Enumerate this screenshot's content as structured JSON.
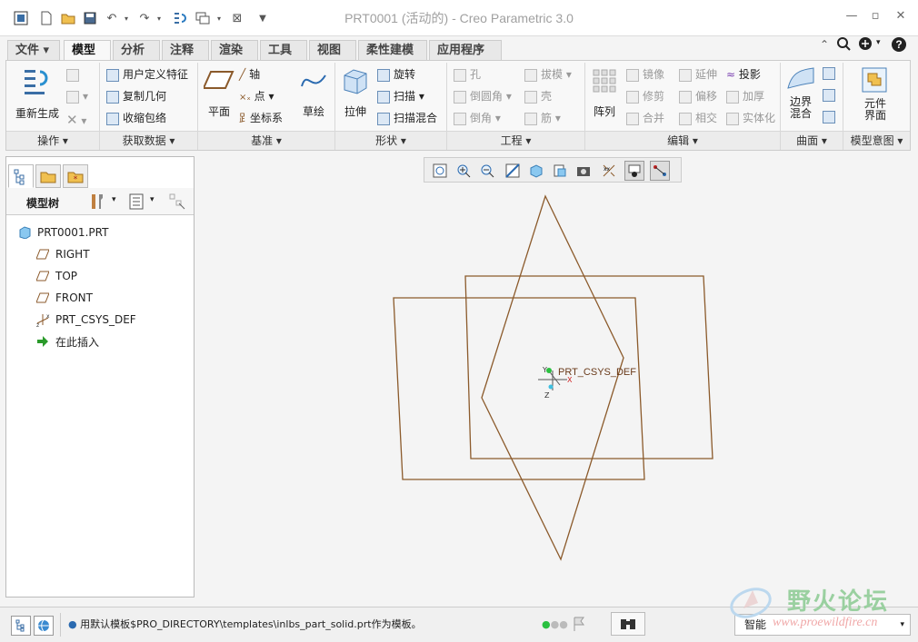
{
  "window": {
    "title": "PRT0001 (活动的) - Creo Parametric 3.0"
  },
  "tabs": [
    {
      "label": "文件",
      "dropdown": true
    },
    {
      "label": "模型",
      "active": true
    },
    {
      "label": "分析"
    },
    {
      "label": "注释"
    },
    {
      "label": "渲染"
    },
    {
      "label": "工具"
    },
    {
      "label": "视图"
    },
    {
      "label": "柔性建模"
    },
    {
      "label": "应用程序"
    }
  ],
  "ribbon": {
    "operations": {
      "group": "操作 ▾",
      "regenerate": "重新生成"
    },
    "get_data": {
      "group": "获取数据 ▾",
      "udf": "用户定义特征",
      "copy_geom": "复制几何",
      "shrinkwrap": "收缩包络"
    },
    "datum": {
      "group": "基准 ▾",
      "plane": "平面",
      "axis": "轴",
      "point": "点",
      "csys": "坐标系",
      "sketch": "草绘"
    },
    "shapes": {
      "group": "形状 ▾",
      "extrude": "拉伸",
      "revolve": "旋转",
      "sweep": "扫描",
      "swept_blend": "扫描混合"
    },
    "engineering": {
      "group": "工程 ▾",
      "hole": "孔",
      "round": "倒圆角",
      "chamfer": "倒角",
      "draft": "拔模",
      "shell": "壳",
      "rib": "筋"
    },
    "editing": {
      "group": "编辑 ▾",
      "pattern": "阵列",
      "mirror": "镜像",
      "trim": "修剪",
      "merge": "合并",
      "extend": "延伸",
      "offset": "偏移",
      "intersect": "相交",
      "project": "投影",
      "thicken": "加厚",
      "solidify": "实体化"
    },
    "surfaces": {
      "group": "曲面 ▾",
      "boundary_blend": "边界混合"
    },
    "model_intent": {
      "group": "模型意图 ▾",
      "component_interface": "元件界面"
    }
  },
  "model_tree": {
    "title": "模型树",
    "items": [
      {
        "label": "PRT0001.PRT",
        "icon": "part-icon"
      },
      {
        "label": "RIGHT",
        "icon": "datum-plane-icon"
      },
      {
        "label": "TOP",
        "icon": "datum-plane-icon"
      },
      {
        "label": "FRONT",
        "icon": "datum-plane-icon"
      },
      {
        "label": "PRT_CSYS_DEF",
        "icon": "csys-icon"
      },
      {
        "label": "在此插入",
        "icon": "insert-here-arrow-icon"
      }
    ]
  },
  "graphics": {
    "csys_label": "PRT_CSYS_DEF",
    "axis_x": "X",
    "axis_y": "Y",
    "axis_z": "Z",
    "plane_color": "#8b5a2b"
  },
  "status": {
    "message": "用默认模板$PRO_DIRECTORY\\templates\\inlbs_part_solid.prt作为模板。",
    "filter": "智能"
  },
  "watermark": {
    "title": "野火论坛",
    "url": "www.proewildfire.cn"
  }
}
